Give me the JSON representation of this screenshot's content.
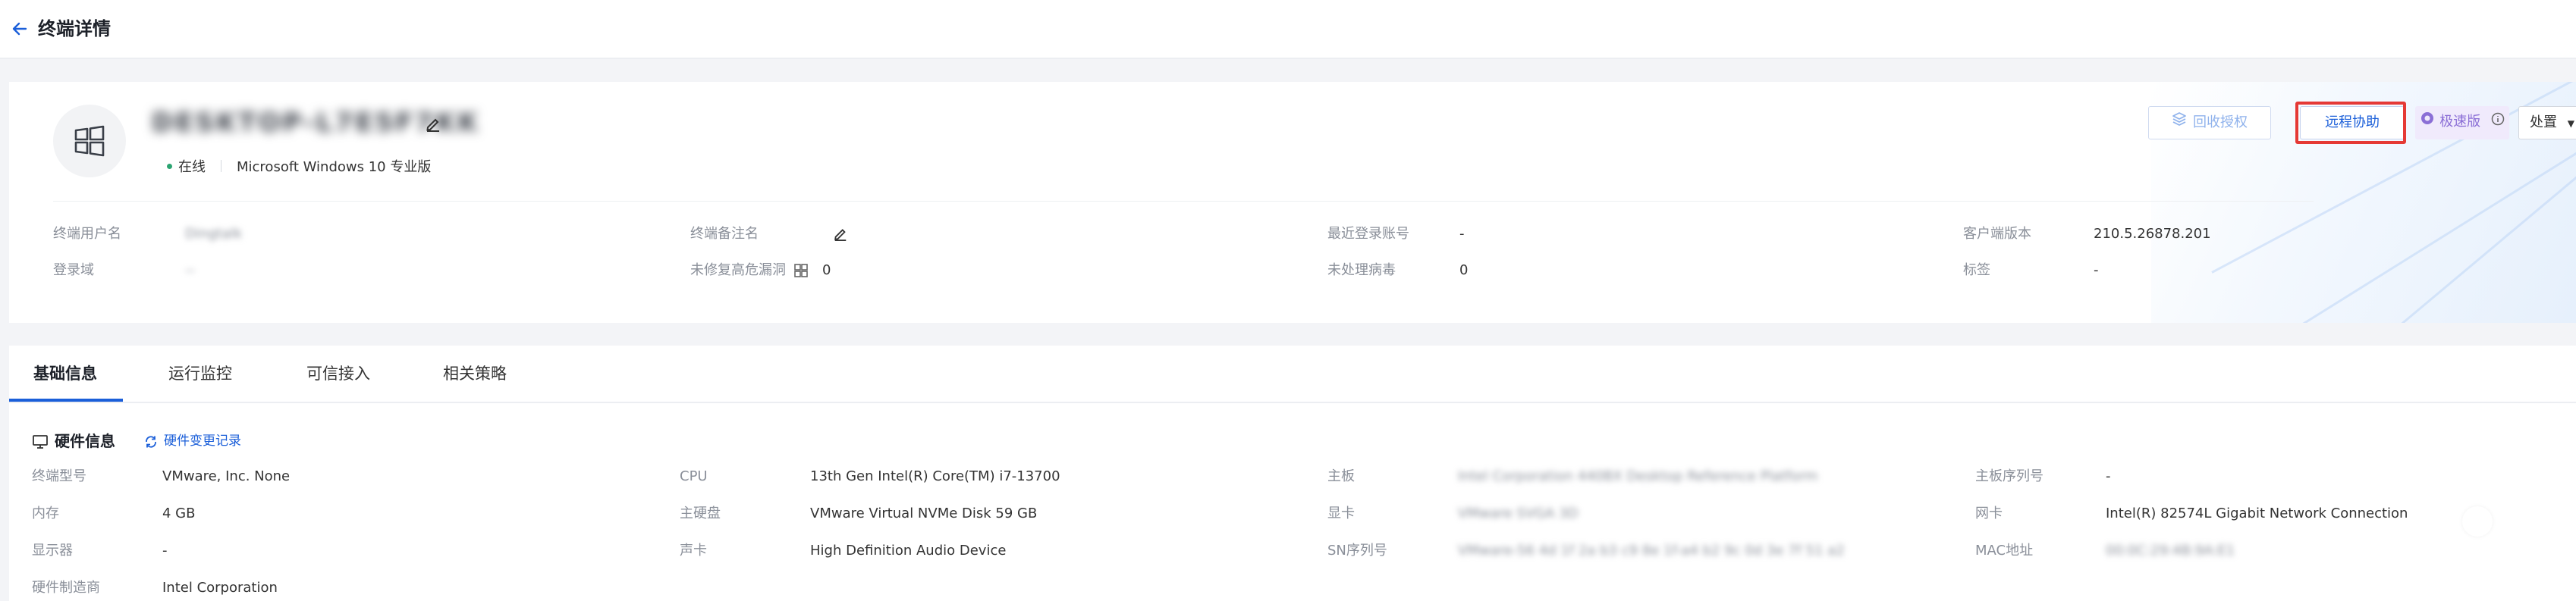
{
  "header": {
    "title": "终端详情"
  },
  "terminal": {
    "hostname": "DESKTOP-L7E5F7KK",
    "status": "在线",
    "os": "Microsoft Windows 10 专业版"
  },
  "actions": {
    "revoke": "回收授权",
    "remote": "远程协助",
    "fast": "极速版",
    "dispose": "处置"
  },
  "overview": {
    "user_label": "终端用户名",
    "user_value": "Dingtalk",
    "domain_label": "登录域",
    "domain_value": "--",
    "remark_label": "终端备注名",
    "vuln_label": "未修复高危漏洞",
    "vuln_value": "0",
    "last_login_label": "最近登录账号",
    "last_login_value": "-",
    "virus_label": "未处理病毒",
    "virus_value": "0",
    "client_version_label": "客户端版本",
    "client_version_value": "210.5.26878.201",
    "tag_label": "标签",
    "tag_value": "-"
  },
  "tabs": [
    {
      "label": "基础信息"
    },
    {
      "label": "运行监控"
    },
    {
      "label": "可信接入"
    },
    {
      "label": "相关策略"
    }
  ],
  "hardware": {
    "title": "硬件信息",
    "history_link": "硬件变更记录",
    "model_label": "终端型号",
    "model_value": "VMware, Inc. None",
    "memory_label": "内存",
    "memory_value": "4 GB",
    "display_label": "显示器",
    "display_value": "-",
    "maker_label": "硬件制造商",
    "maker_value": "Intel Corporation",
    "cpu_label": "CPU",
    "cpu_value": "13th Gen Intel(R) Core(TM) i7-13700",
    "disk_label": "主硬盘",
    "disk_value": "VMware Virtual NVMe Disk 59 GB",
    "sound_label": "声卡",
    "sound_value": "High Definition Audio Device",
    "board_label": "主板",
    "board_value": "Intel Corporation 440BX Desktop Reference Platform",
    "gpu_label": "显卡",
    "gpu_value": "VMware SVGA 3D",
    "sn_label": "SN序列号",
    "sn_value": "VMware-56 4d 1f 2a b3 c9 8e 1f-a4 b2 9c 0d 3e 7f 51 a2",
    "board_sn_label": "主板序列号",
    "board_sn_value": "-",
    "nic_label": "网卡",
    "nic_value": "Intel(R) 82574L Gigabit Network Connection",
    "mac_label": "MAC地址",
    "mac_value": "00:0C:29:4B:9A:E1"
  }
}
